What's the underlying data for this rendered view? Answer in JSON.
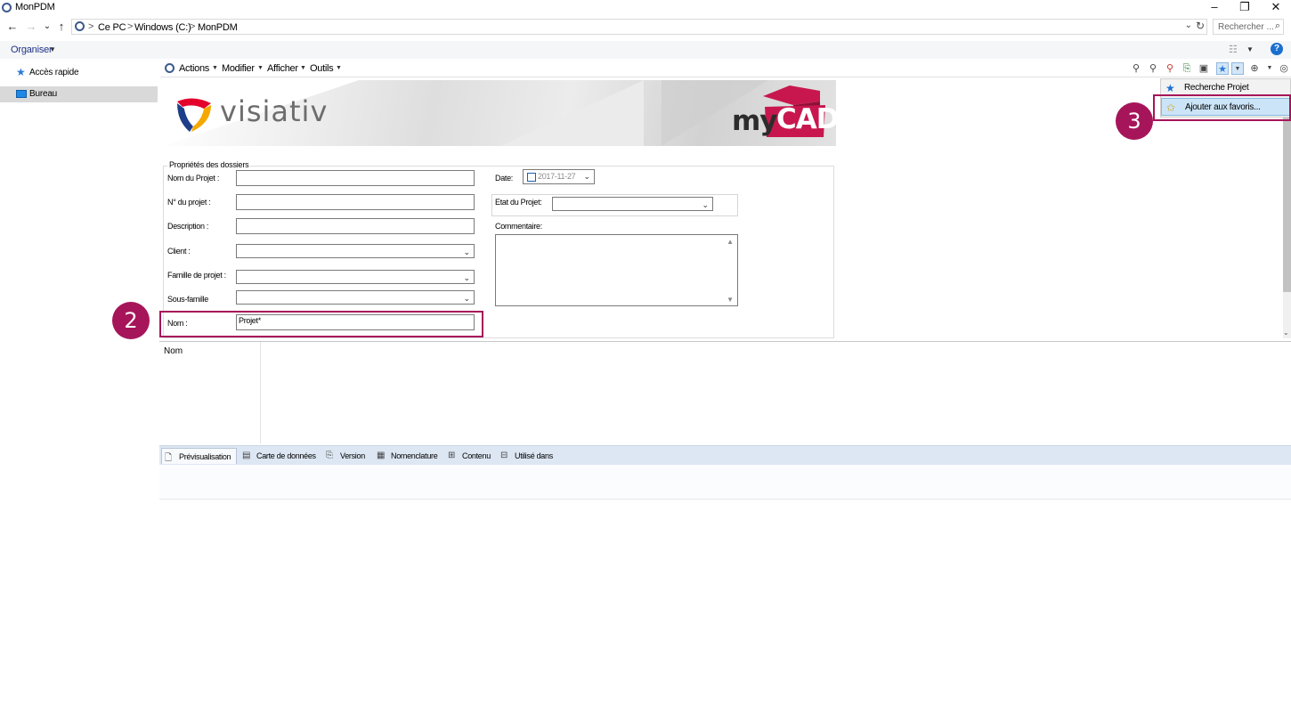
{
  "window": {
    "title": "MonPDM",
    "minimize": "–",
    "restore": "❐",
    "close": "✕"
  },
  "nav": {
    "back": "←",
    "forward": "→",
    "recent": "⌄",
    "up": "↑"
  },
  "address": {
    "crumbs": [
      "Ce PC",
      "Windows (C:)",
      "MonPDM"
    ],
    "separator": ">"
  },
  "search": {
    "placeholder": "Rechercher ..."
  },
  "commandbar": {
    "organiser": "Organiser",
    "help": "?"
  },
  "sidebar": {
    "items": [
      {
        "label": "Accès rapide",
        "icon": "star-icon",
        "selected": false
      },
      {
        "label": "Bureau",
        "icon": "desktop-icon",
        "selected": true
      }
    ]
  },
  "pdm_menu": {
    "items": [
      "Actions",
      "Modifier",
      "Afficher",
      "Outils"
    ]
  },
  "banner": {
    "brand_left": "visiativ",
    "brand_right_my": "my",
    "brand_right_cad": "CAD"
  },
  "form": {
    "legend": "Propriétés des  dossiers",
    "labels": {
      "nom_projet": "Nom du Projet :",
      "num_projet": "N° du projet :",
      "description": "Description :",
      "client": "Client :",
      "famille": "Famille de projet :",
      "sous_famille": "Sous-famille",
      "nom": "Nom :",
      "date": "Date:",
      "etat": "Etat du Projet:",
      "commentaire": "Commentaire:"
    },
    "values": {
      "nom_projet": "",
      "num_projet": "",
      "description": "",
      "client": "",
      "famille": "",
      "sous_famille": "",
      "nom": "Projet*",
      "date": "2017-11-27",
      "etat": "",
      "commentaire": ""
    }
  },
  "dropdown": {
    "items": [
      {
        "label": "Recherche Projet",
        "icon": "star-icon"
      },
      {
        "label": "Ajouter aux favoris...",
        "icon": "star-add-icon",
        "highlighted": true
      }
    ]
  },
  "callouts": {
    "step2": "2",
    "step3": "3"
  },
  "list": {
    "column": "Nom"
  },
  "tabs": [
    {
      "label": "Prévisualisation",
      "icon": "preview-icon",
      "active": true
    },
    {
      "label": "Carte de données",
      "icon": "datacard-icon",
      "active": false
    },
    {
      "label": "Version",
      "icon": "version-icon",
      "active": false
    },
    {
      "label": "Nomenclature",
      "icon": "bom-icon",
      "active": false
    },
    {
      "label": "Contenu",
      "icon": "contains-icon",
      "active": false
    },
    {
      "label": "Utilisé dans",
      "icon": "where-used-icon",
      "active": false
    }
  ],
  "colors": {
    "accent": "#a6155a",
    "folder_link": "#1e3287",
    "help": "#1a6fd0"
  }
}
